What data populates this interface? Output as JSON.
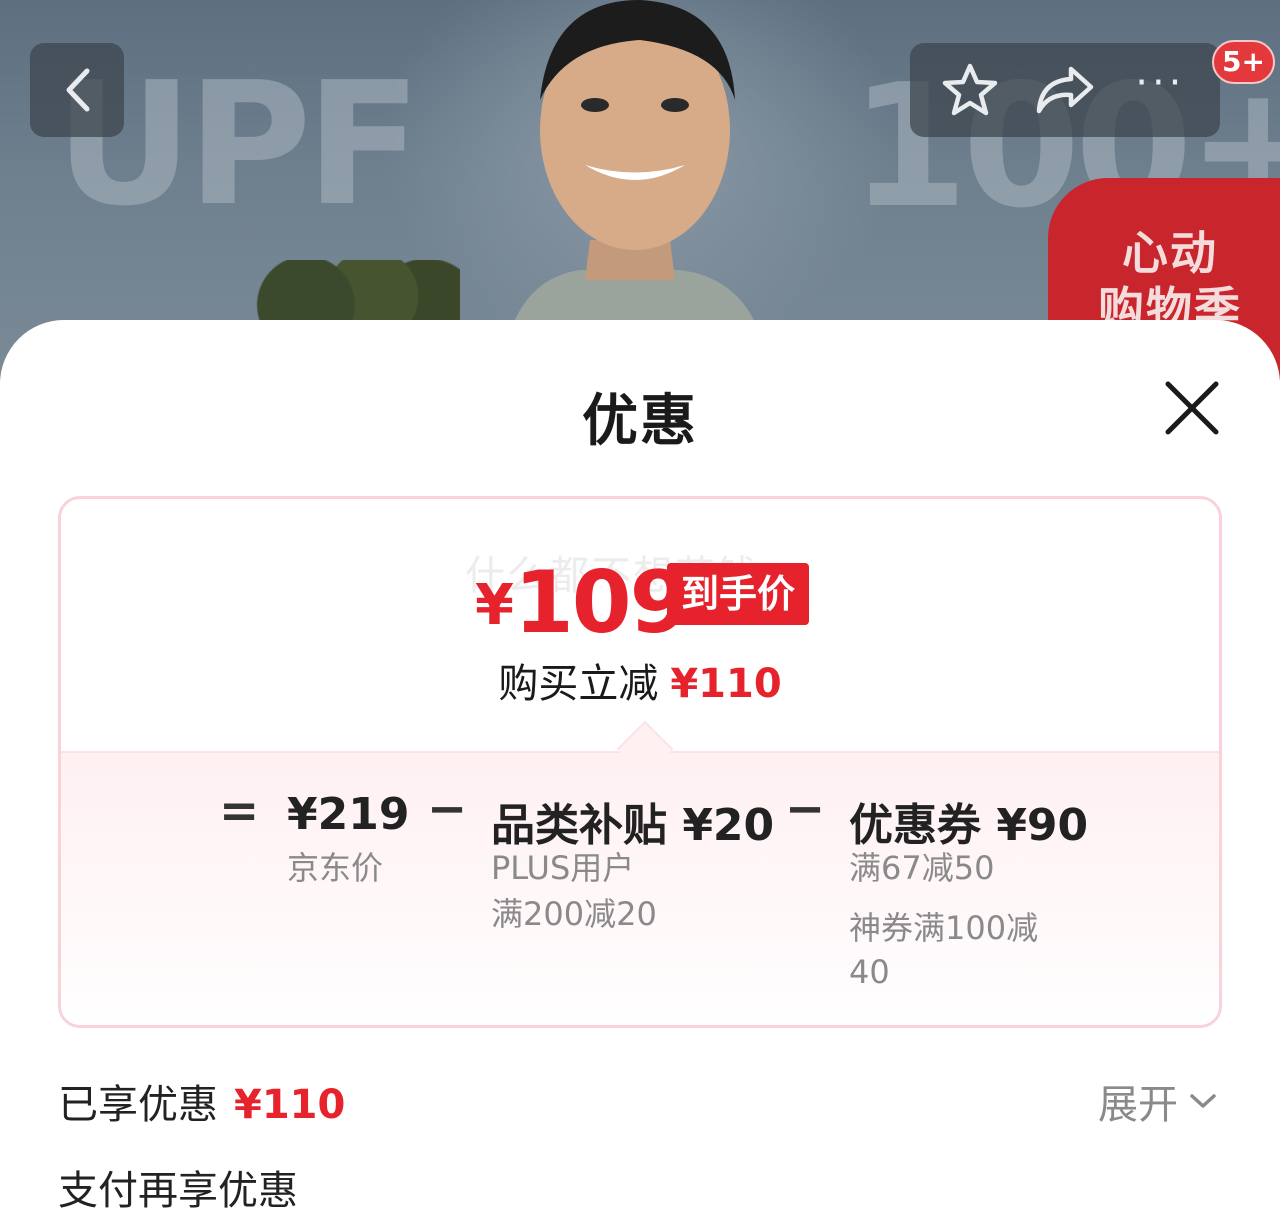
{
  "hero": {
    "big_text_left": "UPF",
    "big_text_right": "100+",
    "badge_text_line1": "心动",
    "badge_text_line2": "购物季",
    "message_count": "5+"
  },
  "nav": {
    "back_icon": "chevron-left-icon",
    "star_icon": "star-icon",
    "share_icon": "share-icon",
    "more_label": "···"
  },
  "sheet": {
    "title": "优惠",
    "close_icon": "close-icon"
  },
  "price_card": {
    "watermark": "什么都不想花钱",
    "currency": "¥",
    "final_price": "109",
    "final_tag": "到手价",
    "reduce_label": "购买立减",
    "reduce_amount": "¥110",
    "breakdown": {
      "equals": "=",
      "jd_price": "¥219",
      "jd_price_label": "京东价",
      "minus1": "−",
      "subsidy_title": "品类补贴 ¥20",
      "subsidy_line1": "PLUS用户",
      "subsidy_line2": "满200减20",
      "minus2": "−",
      "coupon_title": "优惠券 ¥90",
      "coupon_line1": "满67减50",
      "coupon_line2": "神券满100减",
      "coupon_line3": "40"
    }
  },
  "enjoyed": {
    "label": "已享优惠",
    "amount": "¥110",
    "expand_label": "展开"
  },
  "payment": {
    "label": "支付再享优惠"
  },
  "colors": {
    "accent_red": "#e6222c",
    "card_border": "#f9d3d9"
  }
}
